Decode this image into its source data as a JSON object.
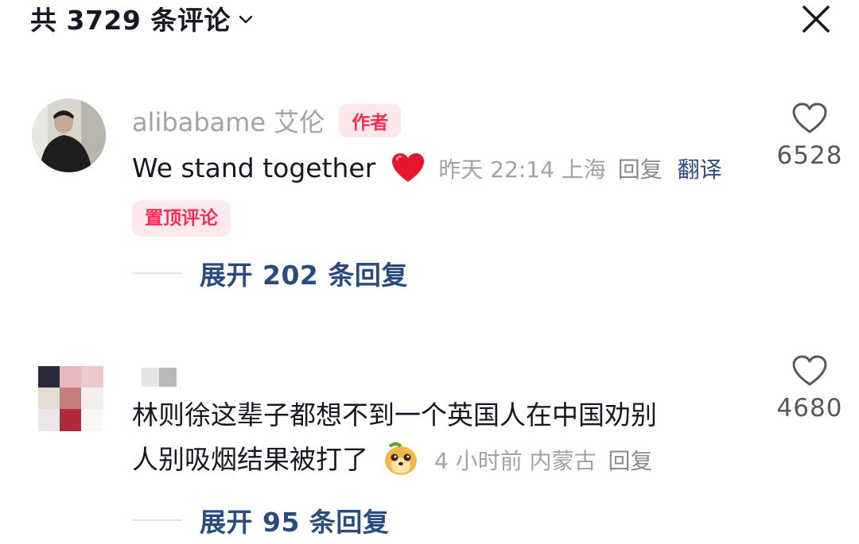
{
  "header": {
    "title": "共 3729 条评论",
    "chevron_icon": "chevron-down-icon",
    "close_icon": "close-icon"
  },
  "comments": [
    {
      "username": "alibabame 艾伦",
      "author_tag": "作者",
      "text": "We stand together",
      "text_emoji": "red-heart-icon",
      "time": "昨天 22:14",
      "location": "上海",
      "reply_label": "回复",
      "translate_label": "翻译",
      "pinned_tag": "置顶评论",
      "expand_label": "展开 202 条回复",
      "like_count": "6528",
      "colors": {
        "accent": "#fe2c55",
        "link": "#2b4a7e"
      }
    },
    {
      "text_line1": "林则徐这辈子都想不到一个英国人在中国劝别",
      "text_line2": "人别吸烟结果被打了",
      "text_emoji": "meerkat-emoji-icon",
      "time": "4 小时前",
      "location": "内蒙古",
      "reply_label": "回复",
      "expand_label": "展开 95 条回复",
      "like_count": "4680"
    }
  ]
}
